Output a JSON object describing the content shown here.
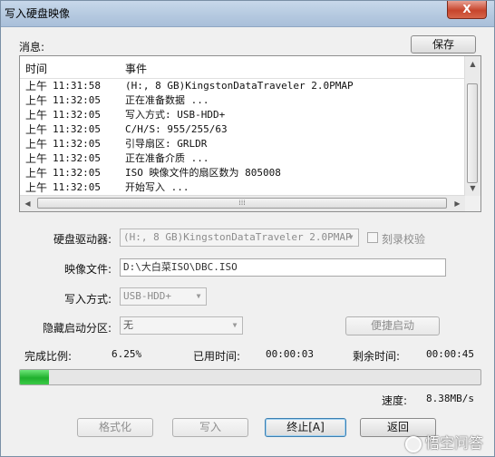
{
  "window": {
    "title": "写入硬盘映像",
    "close_label": "X"
  },
  "messages": {
    "label": "消息:",
    "save_label": "保存",
    "headers": {
      "time": "时间",
      "event": "事件"
    },
    "rows": [
      {
        "ampm": "上午",
        "time": "11:31:58",
        "event": "(H:, 8 GB)KingstonDataTraveler 2.0PMAP"
      },
      {
        "ampm": "上午",
        "time": "11:32:05",
        "event": "正在准备数据 ..."
      },
      {
        "ampm": "上午",
        "time": "11:32:05",
        "event": "写入方式: USB-HDD+"
      },
      {
        "ampm": "上午",
        "time": "11:32:05",
        "event": "C/H/S: 955/255/63"
      },
      {
        "ampm": "上午",
        "time": "11:32:05",
        "event": "引导扇区: GRLDR"
      },
      {
        "ampm": "上午",
        "time": "11:32:05",
        "event": "正在准备介质 ..."
      },
      {
        "ampm": "上午",
        "time": "11:32:05",
        "event": "ISO 映像文件的扇区数为 805008"
      },
      {
        "ampm": "上午",
        "time": "11:32:05",
        "event": "开始写入 ..."
      }
    ]
  },
  "form": {
    "drive_label": "硬盘驱动器:",
    "drive_value": "(H:, 8 GB)KingstonDataTraveler 2.0PMAP",
    "verify_label": "刻录校验",
    "image_label": "映像文件:",
    "image_value": "D:\\大白菜ISO\\DBC.ISO",
    "mode_label": "写入方式:",
    "mode_value": "USB-HDD+",
    "hidden_label": "隐藏启动分区:",
    "hidden_value": "无",
    "quickboot_label": "便捷启动"
  },
  "status": {
    "ratio_label": "完成比例:",
    "ratio_value": "6.25%",
    "progress_fraction": 0.0625,
    "elapsed_label": "已用时间:",
    "elapsed_value": "00:00:03",
    "remaining_label": "剩余时间:",
    "remaining_value": "00:00:45",
    "speed_label": "速度:",
    "speed_value": "8.38MB/s"
  },
  "buttons": {
    "format": "格式化",
    "write": "写入",
    "stop": "终止[A]",
    "back": "返回"
  },
  "watermark": {
    "text": "悟空问答"
  },
  "colors": {
    "progress": "#1fb02d",
    "close": "#c7452c"
  }
}
